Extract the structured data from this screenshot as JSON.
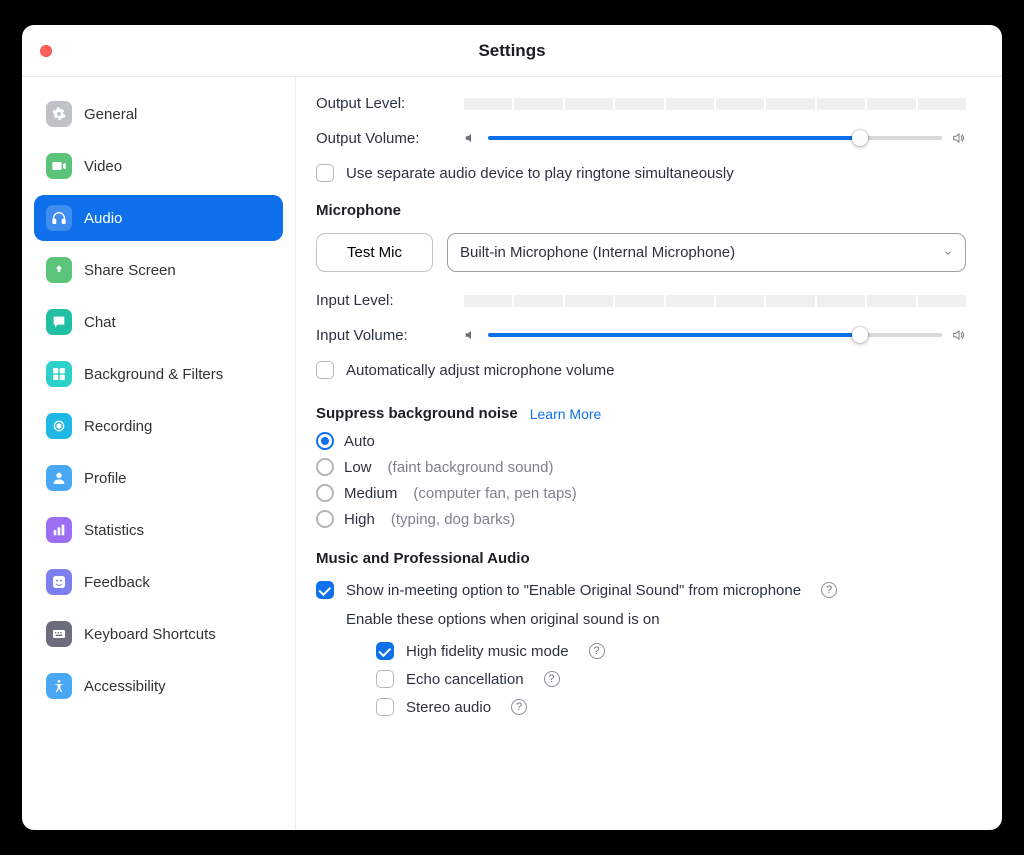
{
  "window": {
    "title": "Settings"
  },
  "sidebar": {
    "items": [
      {
        "label": "General",
        "iconBg": "#bfc3c8"
      },
      {
        "label": "Video",
        "iconBg": "#5cc47a"
      },
      {
        "label": "Audio",
        "iconBg": "#ffffff"
      },
      {
        "label": "Share Screen",
        "iconBg": "#5cc47a"
      },
      {
        "label": "Chat",
        "iconBg": "#21c0a5"
      },
      {
        "label": "Background & Filters",
        "iconBg": "#2ed1c9"
      },
      {
        "label": "Recording",
        "iconBg": "#1fb7e3"
      },
      {
        "label": "Profile",
        "iconBg": "#4aa7f3"
      },
      {
        "label": "Statistics",
        "iconBg": "#9b6ef3"
      },
      {
        "label": "Feedback",
        "iconBg": "#7d7fee"
      },
      {
        "label": "Keyboard Shortcuts",
        "iconBg": "#6b6e7a"
      },
      {
        "label": "Accessibility",
        "iconBg": "#4aa7f3"
      }
    ]
  },
  "audio": {
    "outputLevelLabel": "Output Level:",
    "outputVolumeLabel": "Output Volume:",
    "outputVolumePercent": 82,
    "separateRingtoneLabel": "Use separate audio device to play ringtone simultaneously",
    "micSection": "Microphone",
    "testMic": "Test Mic",
    "micDevice": "Built-in Microphone (Internal Microphone)",
    "inputLevelLabel": "Input Level:",
    "inputVolumeLabel": "Input Volume:",
    "inputVolumePercent": 82,
    "autoAdjustMic": "Automatically adjust microphone volume",
    "suppressTitle": "Suppress background noise",
    "learnMore": "Learn More",
    "suppressOptions": [
      {
        "label": "Auto",
        "hint": ""
      },
      {
        "label": "Low",
        "hint": "(faint background sound)"
      },
      {
        "label": "Medium",
        "hint": "(computer fan, pen taps)"
      },
      {
        "label": "High",
        "hint": "(typing, dog barks)"
      }
    ],
    "proTitle": "Music and Professional Audio",
    "showOriginalSound": "Show in-meeting option to \"Enable Original Sound\" from microphone",
    "enableWhenOriginal": "Enable these options when original sound is on",
    "highFidelity": "High fidelity music mode",
    "echoCancellation": "Echo cancellation",
    "stereoAudio": "Stereo audio"
  }
}
